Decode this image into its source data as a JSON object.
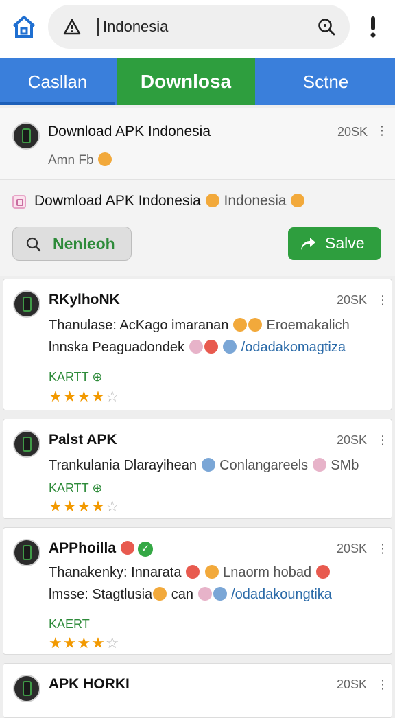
{
  "search": {
    "query": "Indonesia"
  },
  "tabs": [
    "Casllan",
    "Downlosa",
    "Sctne"
  ],
  "featured": {
    "title": "Download APK Indonesia",
    "size": "20SK",
    "subtitle": "Amn Fb"
  },
  "promo": {
    "text": "Dowmload APK Indonesia",
    "tail": "Indonesia"
  },
  "actions": {
    "search_label": "Nenleoh",
    "save_label": "Salve"
  },
  "apps": [
    {
      "name": "RKylhoNK",
      "size": "20SK",
      "line1a": "Thanulase: AcKago imaranan",
      "line1b": "Eroemakalich",
      "line2a": "lnnska Peaguadondek",
      "line2link": "/odadakomagtiza",
      "tag": "KARTT ⊕",
      "rating": 4
    },
    {
      "name": "Palst APK",
      "size": "20SK",
      "line1a": "Trankulania Dlarayihean",
      "line1b": "Conlangareels",
      "line1c": "SMb",
      "tag": "KARTT ⊕",
      "rating": 4
    },
    {
      "name": "APPhoilla",
      "size": "20SK",
      "line1a": "Thanakenky: Innarata",
      "line1b": "Lnaorm hobad",
      "line2a": "lmsse: Stagtlusia",
      "line2b": "can",
      "line2link": "/odadakoungtika",
      "tag": "KAERT",
      "rating": 4
    },
    {
      "name": "APK HORKI",
      "size": "20SK"
    }
  ],
  "colors": {
    "blue_bar": "#3a7fdb",
    "green": "#2e9e3e",
    "star": "#f29900",
    "link": "#2a6aa8"
  }
}
